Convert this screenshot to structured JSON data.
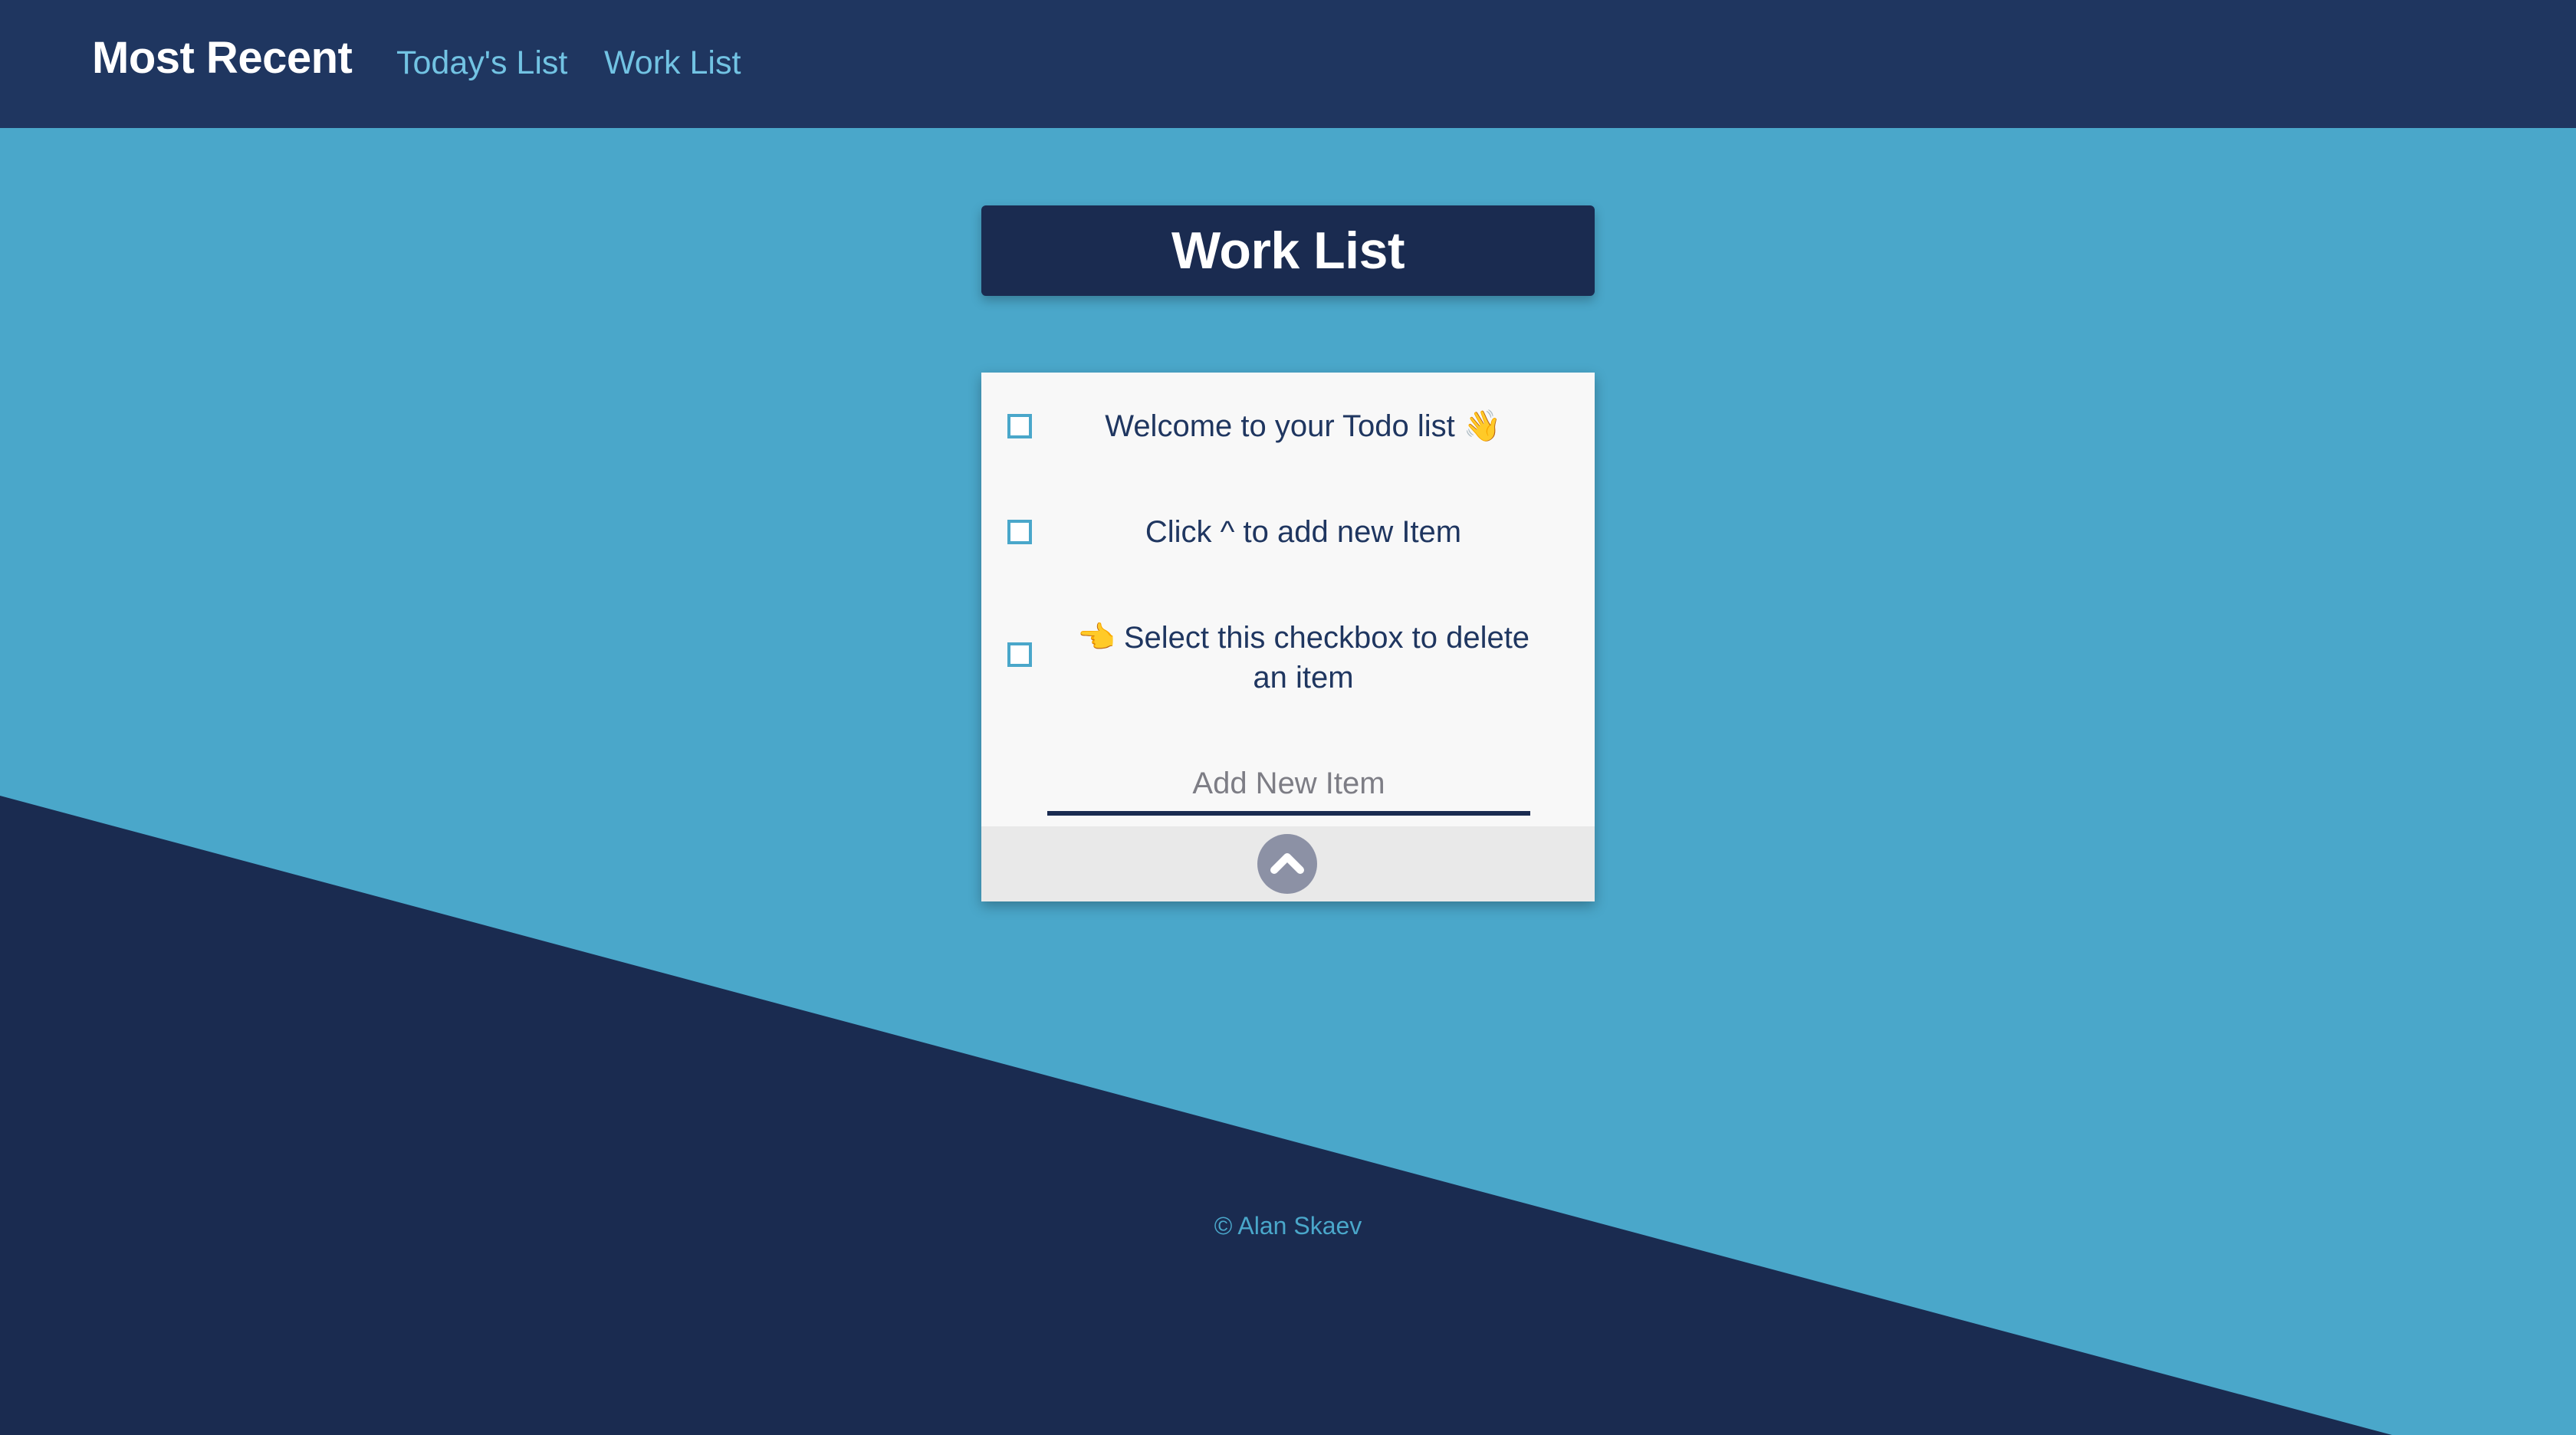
{
  "navbar": {
    "brand": "Most Recent",
    "links": [
      {
        "label": "Today's List"
      },
      {
        "label": "Work List"
      }
    ]
  },
  "list": {
    "title": "Work List",
    "items": [
      {
        "text": "Welcome to your Todo list 👋"
      },
      {
        "text": "Click ^ to add new Item"
      },
      {
        "text": "👈 Select this checkbox to delete an item"
      }
    ],
    "new_item_placeholder": "Add New Item",
    "add_button_icon": "chevron-up-icon"
  },
  "footer": {
    "text": "© Alan Skaev"
  },
  "colors": {
    "background": "#4aa7ca",
    "navbar": "#1f3660",
    "dark_navy": "#1a2b50",
    "nav_link": "#72c3e3",
    "card": "#f8f8f8",
    "card_footer": "#e9e9e9",
    "add_button": "#8c91a5"
  }
}
